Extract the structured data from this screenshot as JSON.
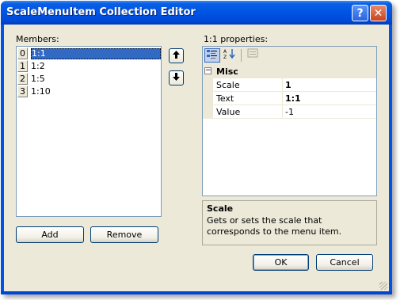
{
  "window": {
    "title": "ScaleMenuItem Collection Editor",
    "help_label": "?",
    "close_label": "✕"
  },
  "members": {
    "label": "Members:",
    "items": [
      {
        "index": "0",
        "text": "1:1",
        "selected": true
      },
      {
        "index": "1",
        "text": "1:2",
        "selected": false
      },
      {
        "index": "2",
        "text": "1:5",
        "selected": false
      },
      {
        "index": "3",
        "text": "1:10",
        "selected": false
      }
    ],
    "move_up_icon": "up-arrow-icon",
    "move_down_icon": "down-arrow-icon",
    "add_label": "Add",
    "remove_label": "Remove"
  },
  "properties": {
    "label": "1:1 properties:",
    "toolbar": [
      "categorized-icon",
      "alphabetical-icon",
      "property-pages-icon"
    ],
    "category": {
      "toggle": "⊟",
      "name": "Misc"
    },
    "rows": [
      {
        "name": "Scale",
        "value": "1",
        "bold": true
      },
      {
        "name": "Text",
        "value": "1:1",
        "bold": true
      },
      {
        "name": "Value",
        "value": "-1",
        "bold": false
      }
    ]
  },
  "description": {
    "title": "Scale",
    "text": "Gets or sets the scale that corresponds to the menu item."
  },
  "buttons": {
    "ok_label": "OK",
    "cancel_label": "Cancel"
  },
  "colors": {
    "title_bar": "#0054e3",
    "selection": "#316ac5",
    "dialog_bg": "#ece9d8"
  }
}
